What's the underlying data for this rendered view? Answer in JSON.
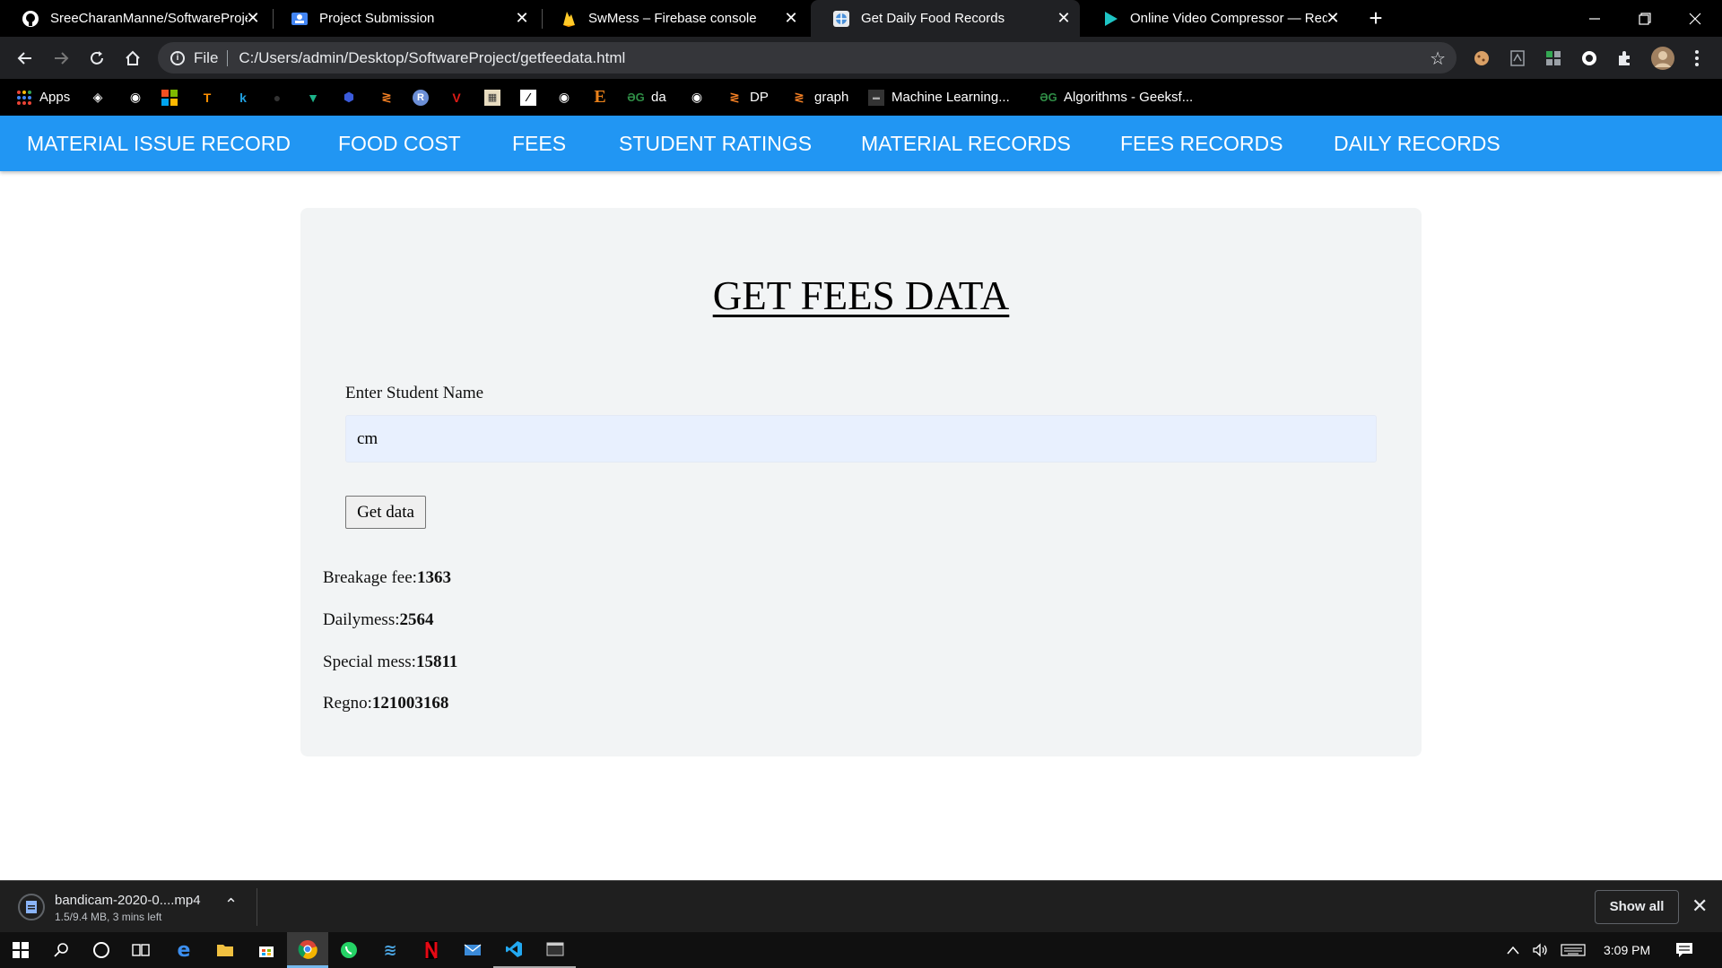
{
  "browser": {
    "tabs": [
      {
        "title": "SreeCharanManne/SoftwareProje",
        "icon": "github-icon",
        "active": false
      },
      {
        "title": "Project Submission",
        "icon": "classroom-icon",
        "active": false
      },
      {
        "title": "SwMess – Firebase console",
        "icon": "firebase-icon",
        "active": false
      },
      {
        "title": "Get Daily Food Records",
        "icon": "page-globe-icon",
        "active": true
      },
      {
        "title": "Online Video Compressor — Red",
        "icon": "play-icon",
        "active": false
      }
    ],
    "address": {
      "scheme": "File",
      "url": "C:/Users/admin/Desktop/SoftwareProject/getfeedata.html"
    },
    "bookmarks": [
      {
        "label": "Apps",
        "icon": "apps-grid-icon"
      },
      {
        "label": "",
        "icon": "bookmark-icon-1"
      },
      {
        "label": "",
        "icon": "globe-icon"
      },
      {
        "label": "",
        "icon": "microsoft-icon"
      },
      {
        "label": "",
        "icon": "tensorflow-icon"
      },
      {
        "label": "",
        "icon": "k-icon"
      },
      {
        "label": "",
        "icon": "github-icon"
      },
      {
        "label": "",
        "icon": "vpn-icon"
      },
      {
        "label": "",
        "icon": "shield-icon"
      },
      {
        "label": "",
        "icon": "stack-icon"
      },
      {
        "label": "",
        "icon": "r-icon"
      },
      {
        "label": "",
        "icon": "angular-icon"
      },
      {
        "label": "",
        "icon": "image-icon"
      },
      {
        "label": "",
        "icon": "chart-icon"
      },
      {
        "label": "",
        "icon": "globe-icon-2"
      },
      {
        "label": "",
        "icon": "e-icon"
      },
      {
        "label": "da",
        "icon": "geeksforgeeks-icon"
      },
      {
        "label": "",
        "icon": "globe-icon-3"
      },
      {
        "label": "DP",
        "icon": "stackoverflow-icon"
      },
      {
        "label": "graph",
        "icon": "stackoverflow-icon-2"
      },
      {
        "label": "Machine Learning...",
        "icon": "ml-icon"
      },
      {
        "label": "Algorithms - Geeksf...",
        "icon": "geeksforgeeks-icon-2"
      }
    ]
  },
  "nav": {
    "items": [
      "MATERIAL ISSUE RECORD",
      "FOOD COST",
      "FEES",
      "STUDENT RATINGS",
      "MATERIAL RECORDS",
      "FEES RECORDS",
      "DAILY RECORDS"
    ]
  },
  "form": {
    "title": "GET FEES DATA",
    "label": "Enter Student Name",
    "value": "cm",
    "button": "Get data"
  },
  "results": [
    {
      "label": "Breakage fee:",
      "value": "1363"
    },
    {
      "label": "Dailymess:",
      "value": "2564"
    },
    {
      "label": "Special mess:",
      "value": "15811"
    },
    {
      "label": "Regno:",
      "value": "121003168"
    }
  ],
  "download": {
    "filename": "bandicam-2020-0....mp4",
    "status": "1.5/9.4 MB, 3 mins left",
    "show_all": "Show all"
  },
  "taskbar": {
    "time": "3:09 PM"
  },
  "colors": {
    "nav_bg": "#2196f3",
    "card_bg": "#f2f4f5",
    "input_bg": "#e8f0fe"
  }
}
